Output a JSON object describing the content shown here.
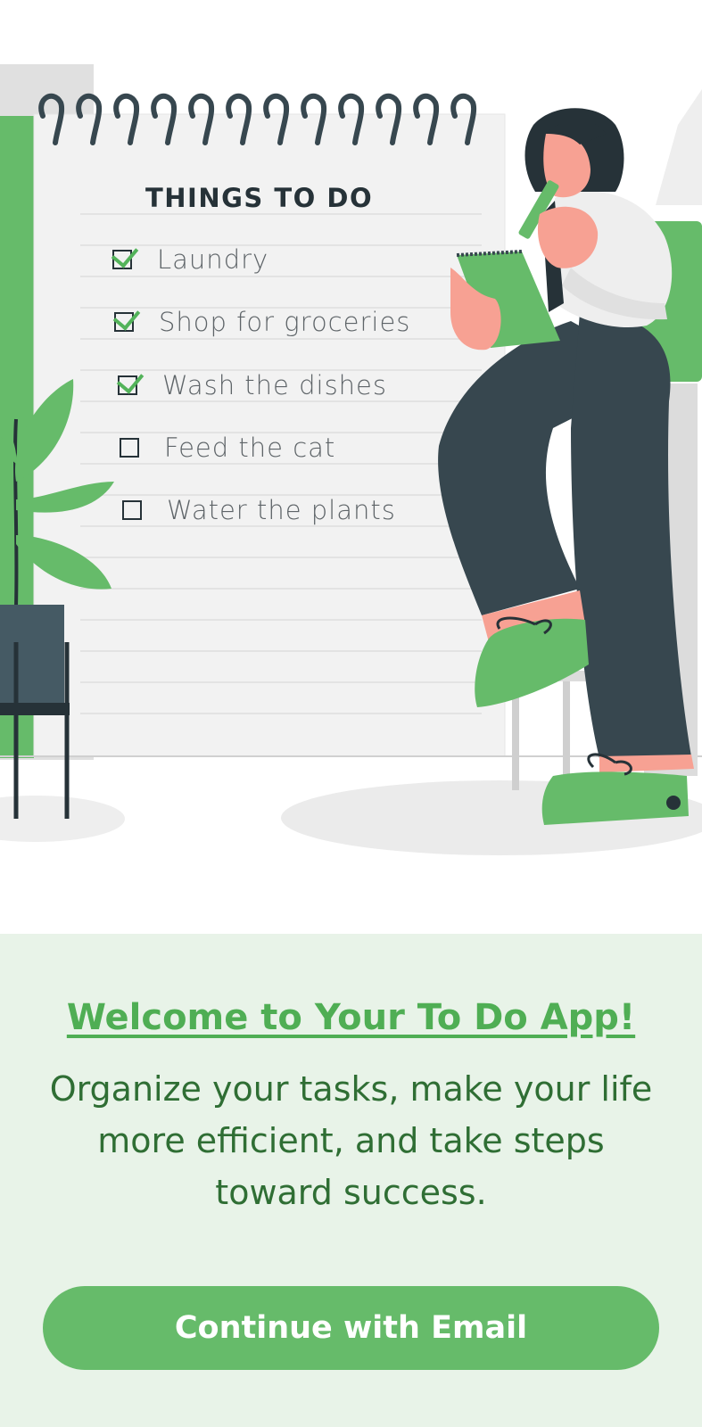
{
  "illustration": {
    "heading": "THINGS TO DO",
    "items": [
      {
        "label": "Laundry",
        "checked": true
      },
      {
        "label": "Shop for groceries",
        "checked": true
      },
      {
        "label": "Wash the dishes",
        "checked": true
      },
      {
        "label": "Feed the cat",
        "checked": false
      },
      {
        "label": "Water the plants",
        "checked": false
      }
    ]
  },
  "welcome": {
    "title": "Welcome to Your To Do App!",
    "subtitle": "Organize your tasks, make your life more efficient, and take steps toward success."
  },
  "cta": {
    "label": "Continue with Email"
  },
  "colors": {
    "accent": "#66bb6a",
    "title": "#4fae54",
    "subtitle": "#2f6e34",
    "panel_bg": "#e8f3e8",
    "ink": "#263238"
  }
}
